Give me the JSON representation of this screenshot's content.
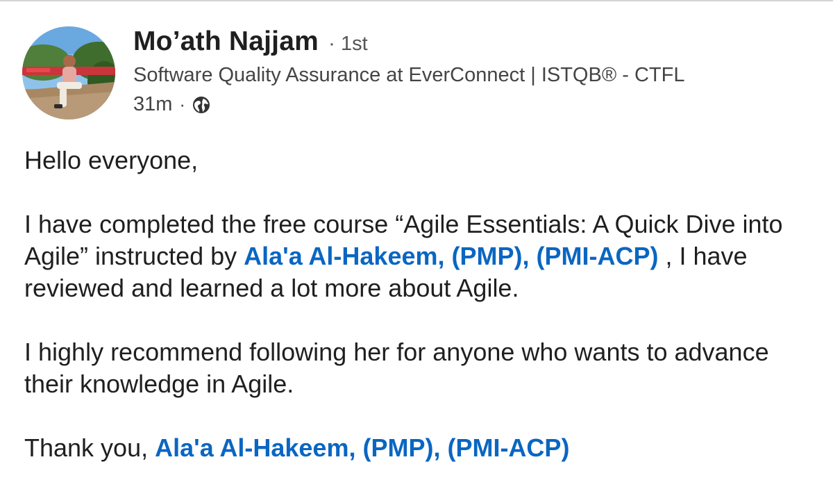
{
  "author": {
    "name": "Mo’ath Najjam",
    "separator": "·",
    "degree": "1st",
    "headline": "Software Quality Assurance at EverConnect | ISTQB® - CTFL",
    "time": "31m",
    "visibility_icon": "globe-icon"
  },
  "post": {
    "greeting": "Hello everyone,",
    "p2_before": "I have completed the free course “Agile Essentials: A Quick Dive into Agile” instructed by ",
    "p2_mention": "Ala'a Al-Hakeem, (PMP), (PMI-ACP)",
    "p2_after": " ,  I have reviewed and learned a lot more about Agile.",
    "p3": "I highly recommend following her for anyone who wants to advance their knowledge in Agile.",
    "p4_before": "Thank you, ",
    "p4_mention": "Ala'a Al-Hakeem, (PMP), (PMI-ACP)"
  },
  "colors": {
    "mention": "#0a66c2",
    "text": "#1f1f1f",
    "muted": "#444444"
  }
}
